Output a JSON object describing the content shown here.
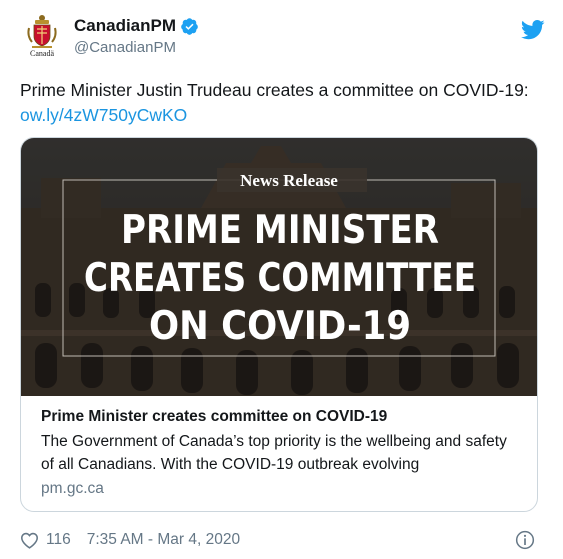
{
  "author": {
    "display_name": "CanadianPM",
    "handle": "@CanadianPM",
    "logo_wordmark": "Canadä",
    "verified": true
  },
  "tweet": {
    "text": "Prime Minister Justin Trudeau creates a committee on COVID-19: ",
    "link": "ow.ly/4zW750yCwKO"
  },
  "card": {
    "image_heading": "News Release",
    "image_lines": [
      "PRIME MINISTER",
      "CREATES COMMITTEE",
      "ON COVID-19"
    ],
    "title": "Prime Minister creates committee on COVID-19",
    "description": "The Government of Canada’s top priority is the wellbeing and safety of all Canadians. With the COVID-19 outbreak evolving",
    "domain": "pm.gc.ca"
  },
  "footer": {
    "likes": "116",
    "timestamp": "7:35 AM - Mar 4, 2020"
  },
  "colors": {
    "link": "#1b95e0",
    "verified": "#1da1f2",
    "secondary_text": "#657786"
  },
  "icons": [
    "canada-coat-of-arms-icon",
    "verified-badge-icon",
    "twitter-bird-icon",
    "heart-icon",
    "info-icon"
  ]
}
